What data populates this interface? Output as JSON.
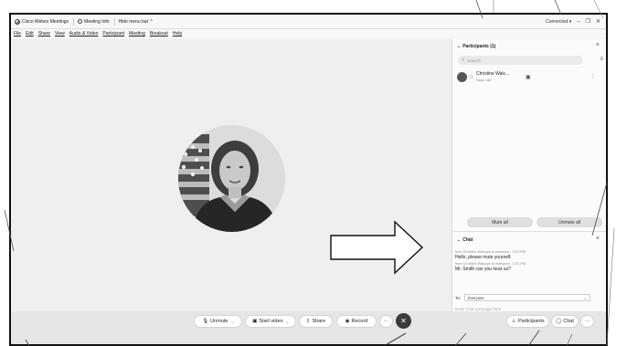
{
  "titlebar": {
    "app_name": "Cisco Webex Meetings",
    "meeting_info": "Meeting Info",
    "hide_menu": "Hide menu bar",
    "hide_menu_chevron": "^",
    "connection": "Connected",
    "connection_chevron": "▾"
  },
  "menu": [
    "File",
    "Edit",
    "Share",
    "View",
    "Audio & Video",
    "Participant",
    "Meeting",
    "Breakout",
    "Help"
  ],
  "participants": {
    "title": "Participants (1)",
    "search_placeholder": "Search",
    "person_name": "Christine Walc...",
    "person_role": "Host, me",
    "mute_all": "Mute all",
    "unmute_all": "Unmute all"
  },
  "chat": {
    "title": "Chat",
    "messages": [
      {
        "from": "from Christine Walczyk to everyone",
        "time": "2:22 PM",
        "text": "Hello, please mute yourself."
      },
      {
        "from": "from Christine Walczyk to everyone",
        "time": "2:22 PM",
        "text": "Mr. Smith can you hear us?"
      }
    ],
    "to_label": "To:",
    "to_value": "Everyone",
    "input_placeholder": "Enter chat message here"
  },
  "toolbar": {
    "unmute": "Unmute",
    "start_video": "Start video",
    "share": "Share",
    "record": "Record",
    "more": "···",
    "end": "✕",
    "participants": "Participants",
    "chat": "Chat"
  },
  "icons": {
    "mic": "mic-off-icon",
    "video": "video-off-icon",
    "share": "share-icon",
    "record": "record-icon",
    "end": "end-call-icon"
  }
}
